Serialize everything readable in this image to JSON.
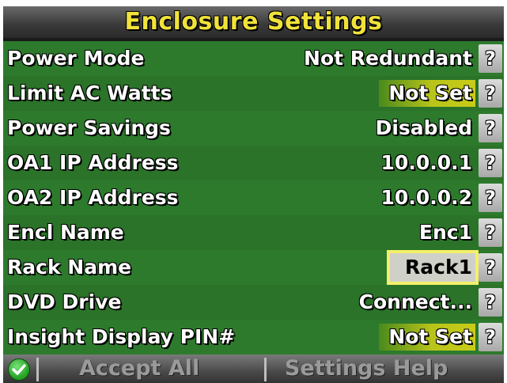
{
  "title": "Enclosure Settings",
  "rows": [
    {
      "label": "Power Mode",
      "value": "Not Redundant",
      "help": "?"
    },
    {
      "label": "Limit AC Watts",
      "value": "Not Set",
      "help": "?"
    },
    {
      "label": "Power Savings",
      "value": "Disabled",
      "help": "?"
    },
    {
      "label": "OA1 IP Address",
      "value": "10.0.0.1",
      "help": "?"
    },
    {
      "label": "OA2 IP Address",
      "value": "10.0.0.2",
      "help": "?"
    },
    {
      "label": "Encl Name",
      "value": "Enc1",
      "help": "?"
    },
    {
      "label": "Rack Name",
      "value": "Rack1",
      "help": "?"
    },
    {
      "label": "DVD Drive",
      "value": "Connect...",
      "help": "?"
    },
    {
      "label": "Insight Display PIN#",
      "value": "Not Set",
      "help": "?"
    }
  ],
  "bottom": {
    "accept_label": "Accept All",
    "help_label": "Settings Help",
    "accept_icon": "check-circle-icon"
  },
  "colors": {
    "title": "#f0e23a",
    "row_background": "#2d7a2d",
    "not_set_highlight": "#c9cc18",
    "selection_border": "#f4f06a",
    "selection_fill": "#cfd0c8",
    "disabled_text": "#9a9a9a"
  }
}
